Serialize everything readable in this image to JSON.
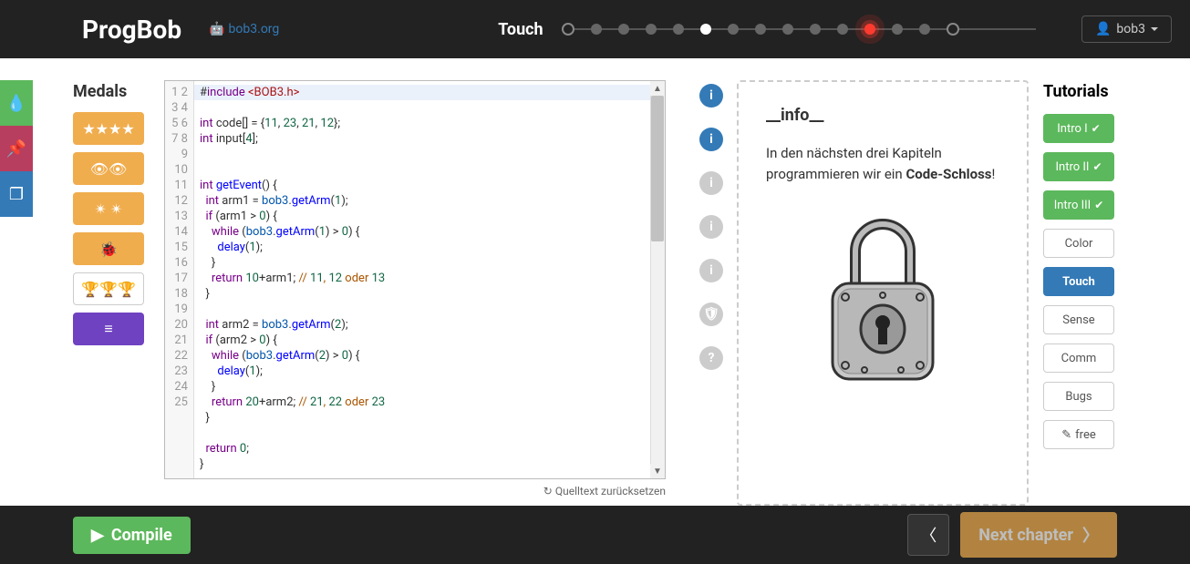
{
  "header": {
    "brand": "ProgBob",
    "domain": "bob3.org",
    "chapter": "Touch",
    "user": "bob3",
    "progress": {
      "total": 15,
      "current_index": 5,
      "pulsing_index": 11
    }
  },
  "sidebar": {
    "medals_title": "Medals"
  },
  "editor": {
    "line_count": 25,
    "code_raw": "#include <BOB3.h>\n\nint code[] = {11, 23, 21, 12};\nint input[4];\n\n\nint getEvent() {\n  int arm1 = bob3.getArm(1);\n  if (arm1 > 0) {\n    while (bob3.getArm(1) > 0) {\n      delay(1);\n    }\n    return 10+arm1; // 11, 12 oder 13\n  }\n\n  int arm2 = bob3.getArm(2);\n  if (arm2 > 0) {\n    while (bob3.getArm(2) > 0) {\n      delay(1);\n    }\n    return 20+arm2; // 21, 22 oder 23\n  }\n\n  return 0;\n}",
    "reset_label": "Quelltext zurücksetzen"
  },
  "info_nav": {
    "items": [
      {
        "icon": "i",
        "active": true
      },
      {
        "icon": "i",
        "active": true
      },
      {
        "icon": "i",
        "active": false
      },
      {
        "icon": "i",
        "active": false
      },
      {
        "icon": "i",
        "active": false
      },
      {
        "icon": "shield",
        "active": false
      },
      {
        "icon": "?",
        "active": false
      }
    ]
  },
  "info": {
    "title": "__info__",
    "text_prefix": "In den nächsten drei Kapiteln programmieren wir ein ",
    "text_bold": "Code-Schloss",
    "text_suffix": "!"
  },
  "tutorials": {
    "title": "Tutorials",
    "items": [
      {
        "label": "Intro I",
        "style": "green",
        "check": true
      },
      {
        "label": "Intro II",
        "style": "green",
        "check": true
      },
      {
        "label": "Intro III",
        "style": "green",
        "check": true
      },
      {
        "label": "Color",
        "style": "white",
        "check": false
      },
      {
        "label": "Touch",
        "style": "blue",
        "check": false
      },
      {
        "label": "Sense",
        "style": "white",
        "check": false
      },
      {
        "label": "Comm",
        "style": "white",
        "check": false
      },
      {
        "label": "Bugs",
        "style": "white",
        "check": false
      }
    ],
    "free_label": "free"
  },
  "footer": {
    "compile": "Compile",
    "next": "Next chapter"
  }
}
